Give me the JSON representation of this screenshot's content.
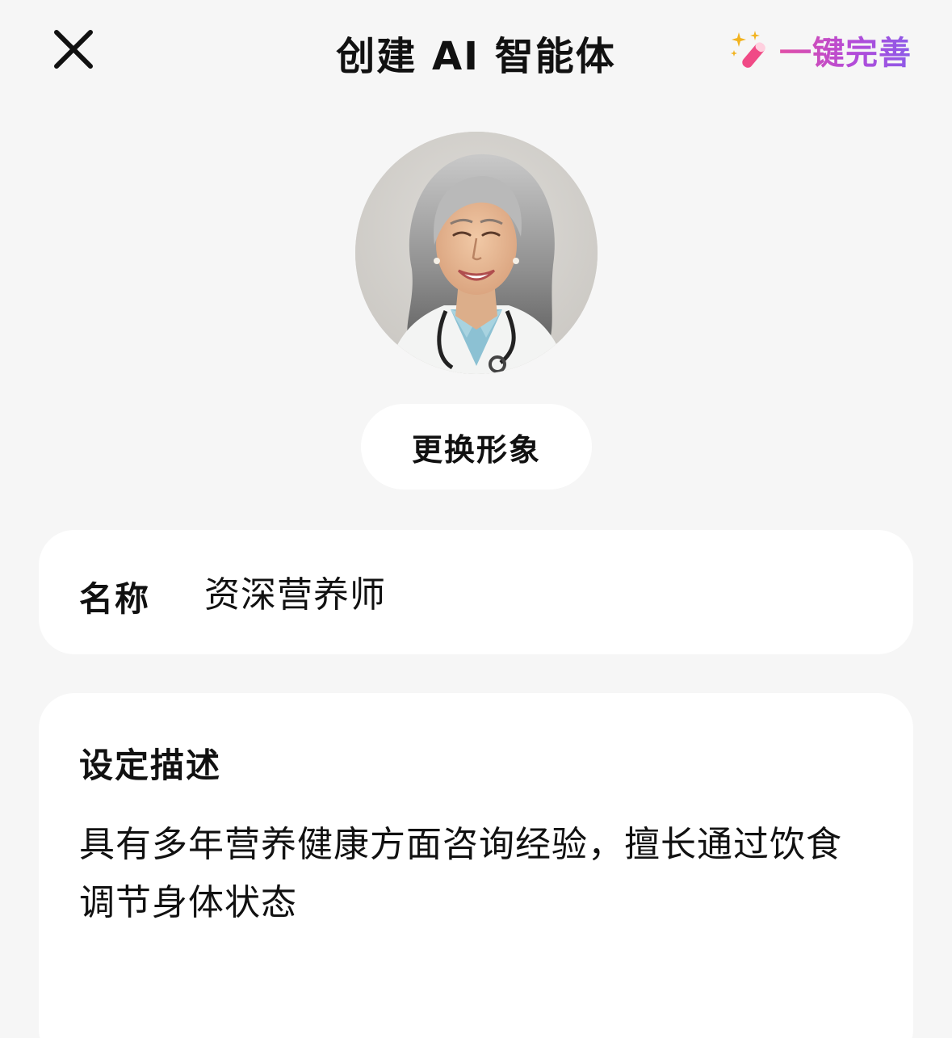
{
  "header": {
    "title": "创建 AI 智能体",
    "close_icon": "close-icon",
    "auto_complete_label": "一键完善",
    "auto_complete_icon": "magic-wand-icon",
    "accent_gradient": [
      "#e14fa6",
      "#b44bd8",
      "#8c5ae8"
    ]
  },
  "avatar": {
    "icon": "avatar-portrait"
  },
  "change_avatar": {
    "label": "更换形象"
  },
  "name_field": {
    "label": "名称",
    "value": "资深营养师"
  },
  "description": {
    "label": "设定描述",
    "value": "具有多年营养健康方面咨询经验，擅长通过饮食调节身体状态"
  },
  "colors": {
    "background": "#f6f6f6",
    "card": "#ffffff",
    "text": "#111111"
  }
}
